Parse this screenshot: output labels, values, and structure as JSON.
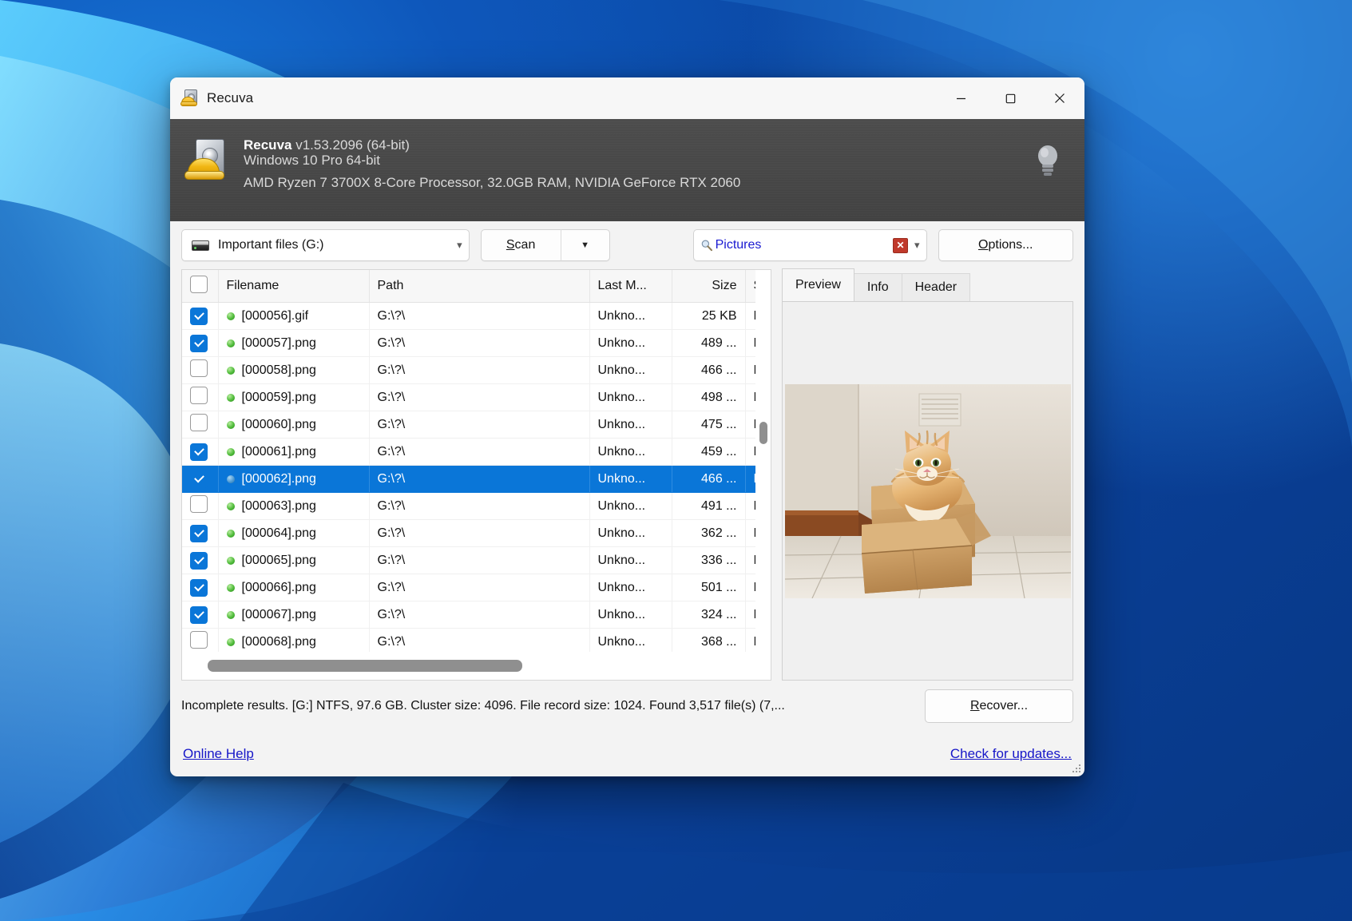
{
  "window": {
    "title": "Recuva",
    "icon": "recuva-hardhat-icon",
    "controls": {
      "minimize": "minimize-icon",
      "maximize": "maximize-icon",
      "close": "close-icon"
    }
  },
  "banner": {
    "app_name": "Recuva",
    "version": "v1.53.2096 (64-bit)",
    "os": "Windows 10 Pro 64-bit",
    "hardware": "AMD Ryzen 7 3700X 8-Core Processor, 32.0GB RAM, NVIDIA GeForce RTX 2060"
  },
  "toolbar": {
    "drive": "Important files (G:)",
    "scan_label": "Scan",
    "scan_accel": "S",
    "scan_rest": "can",
    "filter_value": "Pictures",
    "filter_clear": "✕",
    "options_label": "Options...",
    "options_accel": "O",
    "options_rest": "ptions..."
  },
  "filelist": {
    "columns": [
      "Filename",
      "Path",
      "Last M...",
      "Size",
      "St"
    ],
    "header_checkbox_checked": false,
    "rows": [
      {
        "checked": true,
        "state": "green",
        "name": "[000056].gif",
        "path": "G:\\?\\",
        "modified": "Unkno...",
        "size": "25 KB",
        "status": "Ex",
        "selected": false
      },
      {
        "checked": true,
        "state": "green",
        "name": "[000057].png",
        "path": "G:\\?\\",
        "modified": "Unkno...",
        "size": "489 ...",
        "status": "Ex",
        "selected": false
      },
      {
        "checked": false,
        "state": "green",
        "name": "[000058].png",
        "path": "G:\\?\\",
        "modified": "Unkno...",
        "size": "466 ...",
        "status": "Ex",
        "selected": false
      },
      {
        "checked": false,
        "state": "green",
        "name": "[000059].png",
        "path": "G:\\?\\",
        "modified": "Unkno...",
        "size": "498 ...",
        "status": "Ex",
        "selected": false
      },
      {
        "checked": false,
        "state": "green",
        "name": "[000060].png",
        "path": "G:\\?\\",
        "modified": "Unkno...",
        "size": "475 ...",
        "status": "Ex",
        "selected": false
      },
      {
        "checked": true,
        "state": "green",
        "name": "[000061].png",
        "path": "G:\\?\\",
        "modified": "Unkno...",
        "size": "459 ...",
        "status": "Ex",
        "selected": false
      },
      {
        "checked": true,
        "state": "blue",
        "name": "[000062].png",
        "path": "G:\\?\\",
        "modified": "Unkno...",
        "size": "466 ...",
        "status": "Ex",
        "selected": true
      },
      {
        "checked": false,
        "state": "green",
        "name": "[000063].png",
        "path": "G:\\?\\",
        "modified": "Unkno...",
        "size": "491 ...",
        "status": "Ex",
        "selected": false
      },
      {
        "checked": true,
        "state": "green",
        "name": "[000064].png",
        "path": "G:\\?\\",
        "modified": "Unkno...",
        "size": "362 ...",
        "status": "Ex",
        "selected": false
      },
      {
        "checked": true,
        "state": "green",
        "name": "[000065].png",
        "path": "G:\\?\\",
        "modified": "Unkno...",
        "size": "336 ...",
        "status": "Ex",
        "selected": false
      },
      {
        "checked": true,
        "state": "green",
        "name": "[000066].png",
        "path": "G:\\?\\",
        "modified": "Unkno...",
        "size": "501 ...",
        "status": "Ex",
        "selected": false
      },
      {
        "checked": true,
        "state": "green",
        "name": "[000067].png",
        "path": "G:\\?\\",
        "modified": "Unkno...",
        "size": "324 ...",
        "status": "Ex",
        "selected": false
      },
      {
        "checked": false,
        "state": "green",
        "name": "[000068].png",
        "path": "G:\\?\\",
        "modified": "Unkno...",
        "size": "368 ...",
        "status": "Ex",
        "selected": false
      }
    ]
  },
  "preview": {
    "tabs": [
      {
        "label": "Preview",
        "active": true
      },
      {
        "label": "Info",
        "active": false
      },
      {
        "label": "Header",
        "active": false
      }
    ],
    "image_alt": "ginger-kitten-in-cardboard-box"
  },
  "status": {
    "text": "Incomplete results. [G:] NTFS, 97.6 GB. Cluster size: 4096. File record size: 1024. Found 3,517 file(s) (7,...",
    "recover_label": "Recover...",
    "recover_accel": "R",
    "recover_rest": "ecover..."
  },
  "footer": {
    "online_help": "Online Help",
    "check_updates": "Check for updates..."
  },
  "colors": {
    "selection": "#0a76d8",
    "link": "#1616c8",
    "filter_text": "#1a1ad1",
    "banner_bg": "#474747",
    "window_bg": "#f3f3f3"
  }
}
